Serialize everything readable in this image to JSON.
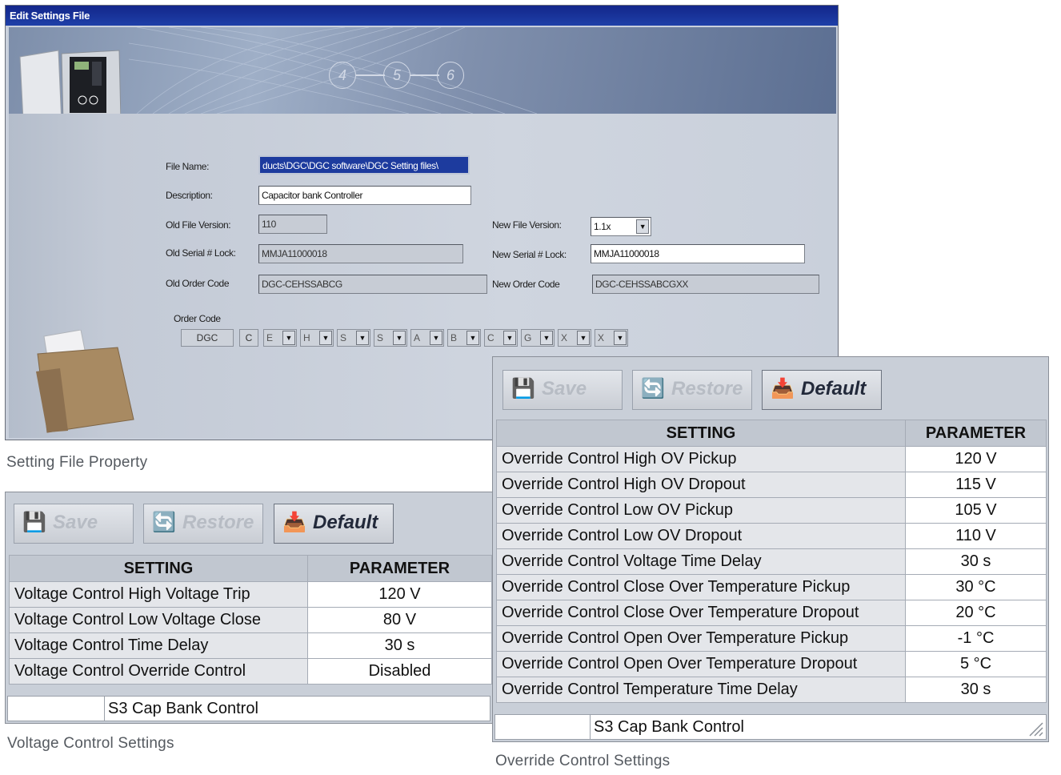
{
  "edit_window": {
    "title": "Edit Settings File",
    "steps": [
      "4",
      "5",
      "6"
    ],
    "file_name_label": "File Name:",
    "file_name_value": "ducts\\DGC\\DGC software\\DGC Setting files\\",
    "description_label": "Description:",
    "description_value": "Capacitor bank Controller",
    "old_file_version_label": "Old File Version:",
    "old_file_version_value": "110",
    "new_file_version_label": "New File Version:",
    "new_file_version_value": "1.1x",
    "old_serial_label": "Old Serial # Lock:",
    "old_serial_value": "MMJA11000018",
    "new_serial_label": "New Serial # Lock:",
    "new_serial_value": "MMJA11000018",
    "old_order_label": "Old Order Code",
    "old_order_value": "DGC-CEHSSABCG",
    "new_order_label": "New Order Code",
    "new_order_value": "DGC-CEHSSABCGXX",
    "order_code_label": "Order Code",
    "order_code_fixed": [
      "DGC",
      "C"
    ],
    "order_code_options": [
      "E",
      "H",
      "S",
      "S",
      "A",
      "B",
      "C",
      "G",
      "X",
      "X"
    ]
  },
  "voltage_panel": {
    "buttons": {
      "save": "Save",
      "restore": "Restore",
      "default": "Default"
    },
    "headers": {
      "setting": "SETTING",
      "parameter": "PARAMETER"
    },
    "rows": [
      {
        "setting": "Voltage Control High Voltage Trip",
        "parameter": "120 V"
      },
      {
        "setting": "Voltage Control Low Voltage Close",
        "parameter": "80 V"
      },
      {
        "setting": "Voltage Control Time Delay",
        "parameter": "30 s"
      },
      {
        "setting": "Voltage Control Override Control",
        "parameter": "Disabled"
      }
    ],
    "status": "S3 Cap Bank Control"
  },
  "override_panel": {
    "buttons": {
      "save": "Save",
      "restore": "Restore",
      "default": "Default"
    },
    "headers": {
      "setting": "SETTING",
      "parameter": "PARAMETER"
    },
    "rows": [
      {
        "setting": "Override Control High OV Pickup",
        "parameter": "120 V"
      },
      {
        "setting": "Override Control High OV Dropout",
        "parameter": "115 V"
      },
      {
        "setting": "Override Control Low OV Pickup",
        "parameter": "105 V"
      },
      {
        "setting": "Override Control Low OV Dropout",
        "parameter": "110 V"
      },
      {
        "setting": "Override Control Voltage Time Delay",
        "parameter": "30 s"
      },
      {
        "setting": "Override Control Close Over Temperature Pickup",
        "parameter": "30 °C"
      },
      {
        "setting": "Override Control Close Over Temperature Dropout",
        "parameter": "20 °C"
      },
      {
        "setting": "Override Control Open Over Temperature Pickup",
        "parameter": "-1 °C"
      },
      {
        "setting": "Override Control Open Over Temperature Dropout",
        "parameter": "5 °C"
      },
      {
        "setting": "Override Control Temperature Time Delay",
        "parameter": "30 s"
      }
    ],
    "status": "S3 Cap Bank Control"
  },
  "captions": {
    "setting_file": "Setting File Property",
    "voltage": "Voltage Control Settings",
    "override": "Override Control Settings"
  },
  "icons": [
    "controller-cabinet-icon",
    "folder-icon",
    "save-icon",
    "restore-icon",
    "default-icon",
    "dropdown-arrow-icon",
    "resize-grip-icon"
  ]
}
